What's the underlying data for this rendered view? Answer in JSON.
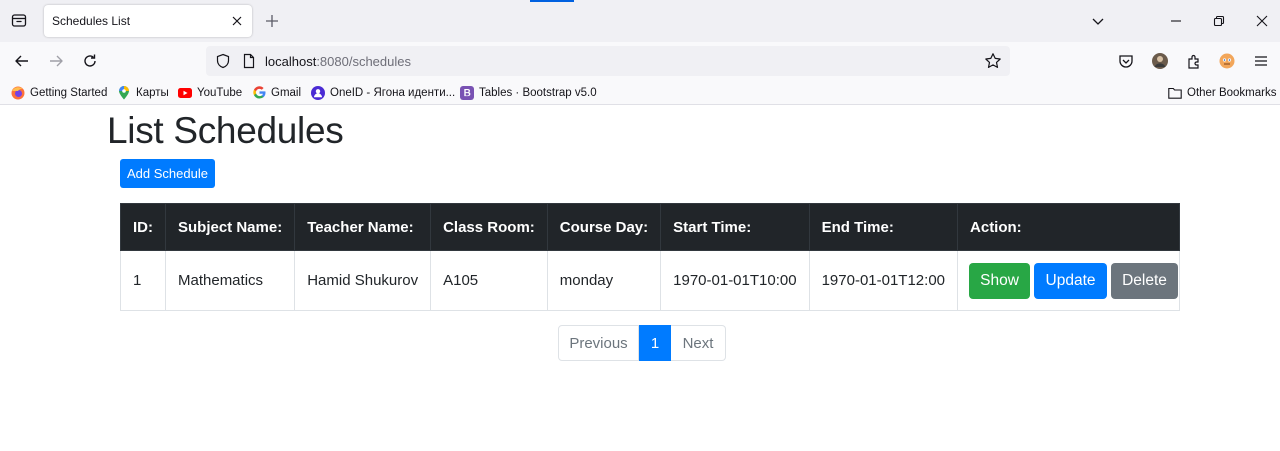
{
  "browser": {
    "tab": {
      "title": "Schedules List"
    },
    "url": {
      "host": "localhost",
      "rest": ":8080/schedules"
    },
    "bookmarks": [
      {
        "label": "Getting Started",
        "icon": "firefox-icon"
      },
      {
        "label": "Карты",
        "icon": "maps-pin-icon"
      },
      {
        "label": "YouTube",
        "icon": "youtube-icon"
      },
      {
        "label": "Gmail",
        "icon": "google-icon"
      },
      {
        "label": "OneID - Ягона иденти...",
        "icon": "oneid-icon"
      },
      {
        "label": "Tables · Bootstrap v5.0",
        "icon": "bootstrap-icon"
      }
    ],
    "other_bookmarks": "Other Bookmarks"
  },
  "page": {
    "title": "List Schedules",
    "add_button": "Add Schedule",
    "table": {
      "headers": [
        "ID:",
        "Subject Name:",
        "Teacher Name:",
        "Class Room:",
        "Course Day:",
        "Start Time:",
        "End Time:",
        "Action:"
      ],
      "rows": [
        {
          "id": "1",
          "subject": "Mathematics",
          "teacher": "Hamid Shukurov",
          "room": "A105",
          "day": "monday",
          "start": "1970-01-01T10:00",
          "end": "1970-01-01T12:00",
          "actions": {
            "show": "Show",
            "update": "Update",
            "delete": "Delete"
          }
        }
      ]
    },
    "pagination": {
      "previous": "Previous",
      "current": "1",
      "next": "Next"
    }
  },
  "colors": {
    "primary": "#007bff",
    "success": "#28a745",
    "secondary": "#6c757d",
    "table_header": "#212529"
  }
}
